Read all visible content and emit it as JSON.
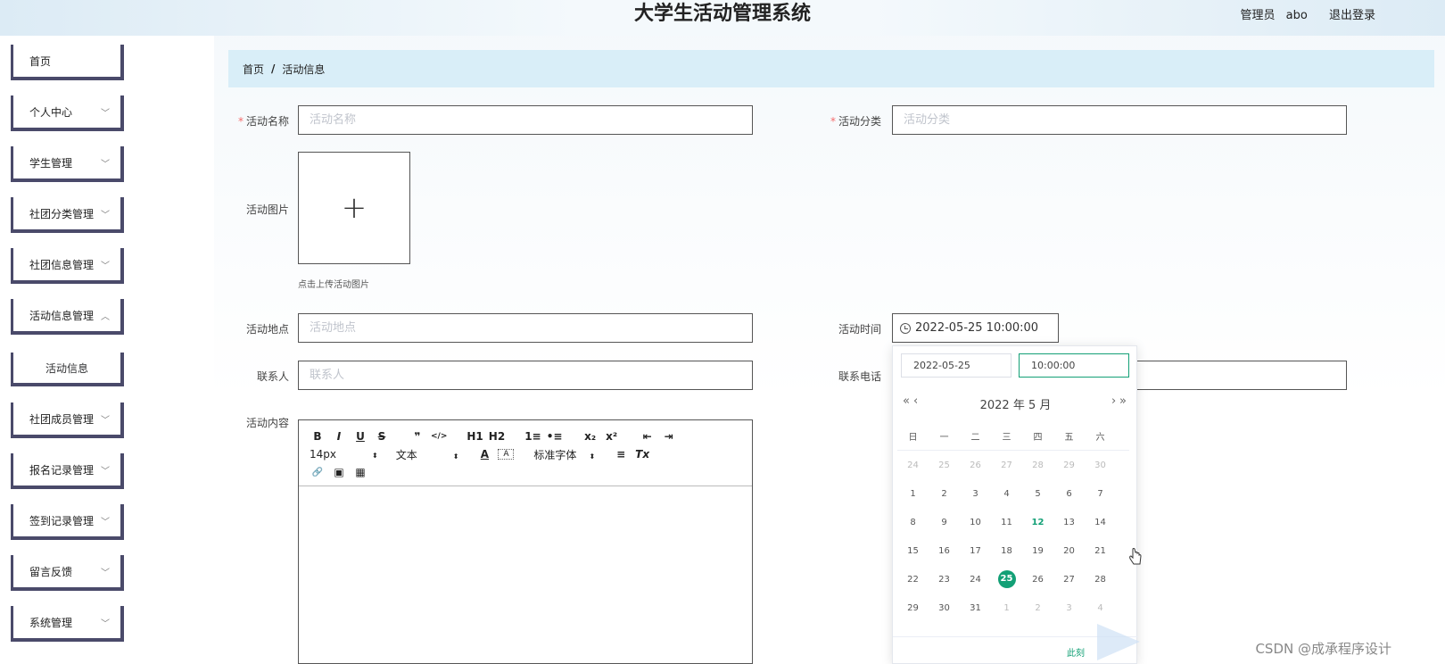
{
  "header": {
    "title": "大学生活动管理系统",
    "role": "管理员",
    "username": "abo",
    "logout_label": "退出登录"
  },
  "sidebar": {
    "items": [
      {
        "label": "首页",
        "has_children": false
      },
      {
        "label": "个人中心",
        "has_children": true
      },
      {
        "label": "学生管理",
        "has_children": true
      },
      {
        "label": "社团分类管理",
        "has_children": true
      },
      {
        "label": "社团信息管理",
        "has_children": true
      },
      {
        "label": "活动信息管理",
        "has_children": true,
        "expanded": true
      },
      {
        "label": "社团成员管理",
        "has_children": true
      },
      {
        "label": "报名记录管理",
        "has_children": true
      },
      {
        "label": "签到记录管理",
        "has_children": true
      },
      {
        "label": "留言反馈",
        "has_children": true
      },
      {
        "label": "系统管理",
        "has_children": true
      }
    ],
    "sub_item": "活动信息"
  },
  "breadcrumb": {
    "home": "首页",
    "separator": "/",
    "current": "活动信息"
  },
  "form": {
    "name": {
      "label": "活动名称",
      "required": true,
      "placeholder": "活动名称",
      "value": ""
    },
    "category": {
      "label": "活动分类",
      "required": true,
      "placeholder": "活动分类",
      "value": ""
    },
    "image": {
      "label": "活动图片",
      "upload_icon": "+",
      "hint": "点击上传活动图片"
    },
    "location": {
      "label": "活动地点",
      "placeholder": "活动地点",
      "value": ""
    },
    "time": {
      "label": "活动时间",
      "value": "2022-05-25 10:00:00"
    },
    "contact": {
      "label": "联系人",
      "placeholder": "联系人",
      "value": ""
    },
    "phone": {
      "label": "联系电话",
      "placeholder": "",
      "value": ""
    },
    "content": {
      "label": "活动内容",
      "toolbar": {
        "bold": "B",
        "italic": "I",
        "underline": "U",
        "strike": "S",
        "quote": "❞",
        "code": "</>",
        "h1": "H1",
        "h2": "H2",
        "ordered_list": "1≡",
        "bullet_list": "•≡",
        "subscript": "x₂",
        "superscript": "x²",
        "outdent": "⇤",
        "indent": "⇥",
        "size": "14px",
        "format": "文本",
        "color": "A",
        "background": "A",
        "font": "标准字体",
        "align": "≡",
        "clear": "Tx",
        "link": "🔗",
        "image": "▣",
        "video": "▦"
      }
    }
  },
  "datepicker": {
    "date_input": "2022-05-25",
    "time_input": "10:00:00",
    "header_year": "2022",
    "header_year_suffix": "年",
    "header_month": "5",
    "header_month_suffix": "月",
    "prev_year": "«",
    "prev_month": "‹",
    "next_month": "›",
    "next_year": "»",
    "weekdays": [
      "日",
      "一",
      "二",
      "三",
      "四",
      "五",
      "六"
    ],
    "weeks": [
      [
        "24",
        "25",
        "26",
        "27",
        "28",
        "29",
        "30"
      ],
      [
        "1",
        "2",
        "3",
        "4",
        "5",
        "6",
        "7"
      ],
      [
        "8",
        "9",
        "10",
        "11",
        "12",
        "13",
        "14"
      ],
      [
        "15",
        "16",
        "17",
        "18",
        "19",
        "20",
        "21"
      ],
      [
        "22",
        "23",
        "24",
        "25",
        "26",
        "27",
        "28"
      ],
      [
        "29",
        "30",
        "31",
        "1",
        "2",
        "3",
        "4"
      ]
    ],
    "today": "12",
    "selected": "25",
    "now_label": "此刻"
  },
  "watermark": "CSDN @成承程序设计",
  "colors": {
    "accent": "#13a076",
    "breadcrumb_bg": "#d9eef8",
    "menu_border": "#4a4a6a",
    "required": "#f56c6c"
  }
}
